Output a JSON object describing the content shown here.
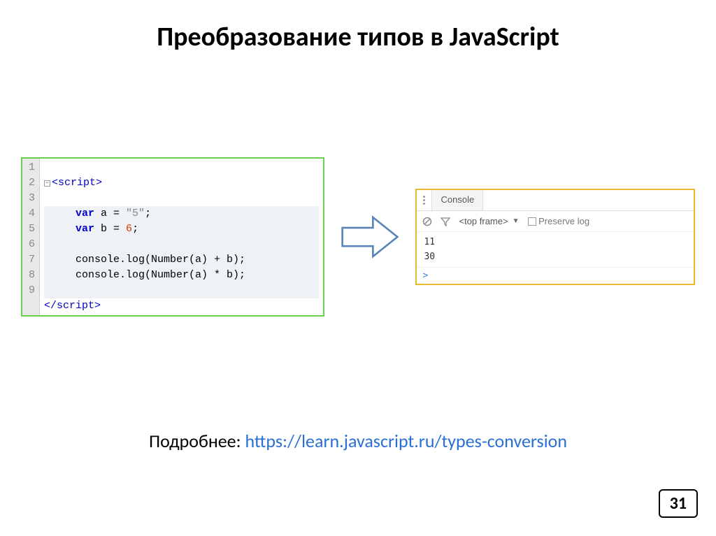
{
  "title": "Преобразование типов в JavaScript",
  "code": {
    "lines": [
      "1",
      "2",
      "3",
      "4",
      "5",
      "6",
      "7",
      "8",
      "9"
    ],
    "open_tag": "<script>",
    "close_tag": "</script>",
    "kw_var": "var",
    "a_name": " a = ",
    "a_val": "\"5\"",
    "b_name": " b = ",
    "b_val": "6",
    "semi": ";",
    "log1": "console.log(Number(a) + b);",
    "log2": "console.log(Number(a) * b);"
  },
  "console": {
    "tab": "Console",
    "frame": "<top frame>",
    "preserve": "Preserve log",
    "out1": "11",
    "out2": "30",
    "prompt": ">"
  },
  "footer": {
    "label": "Подробнее: ",
    "url": "https://learn.javascript.ru/types-conversion"
  },
  "page": "31"
}
